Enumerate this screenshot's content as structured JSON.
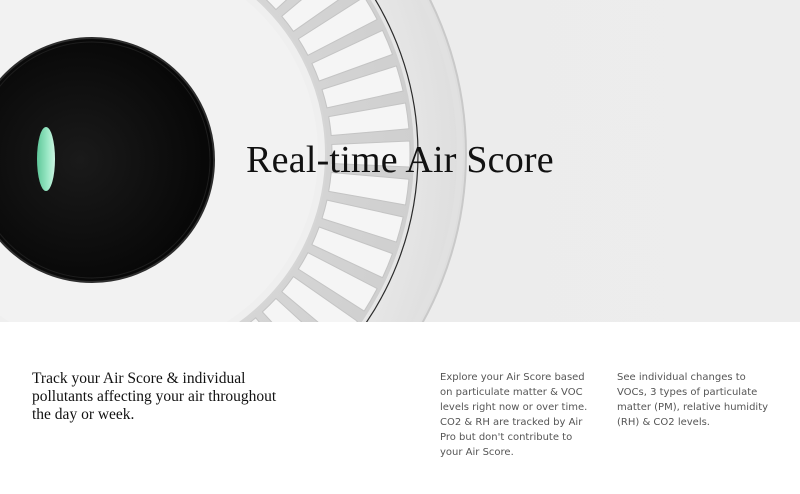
{
  "hero": {
    "title": "Real-time Air Score"
  },
  "info": {
    "headline": "Track your Air Score & individual pollutants affecting your air throughout the day or week.",
    "column_1": "Explore your Air Score based on particulate matter & VOC levels right now or over time. CO2 & RH are tracked by Air Pro but don't contribute to your Air Score.",
    "column_2": "See individual changes to VOCs, 3 types of particulate matter (PM), relative humidity (RH) & CO2 levels."
  },
  "colors": {
    "background": "#ececec",
    "device_body": "#f4f4f4",
    "display_black": "#0c0c0c",
    "status_light": "#7fd9b0",
    "text_dark": "#111111",
    "text_muted": "#555555"
  },
  "icons": {
    "device": "air-purifier-illustration",
    "status": "status-light"
  }
}
